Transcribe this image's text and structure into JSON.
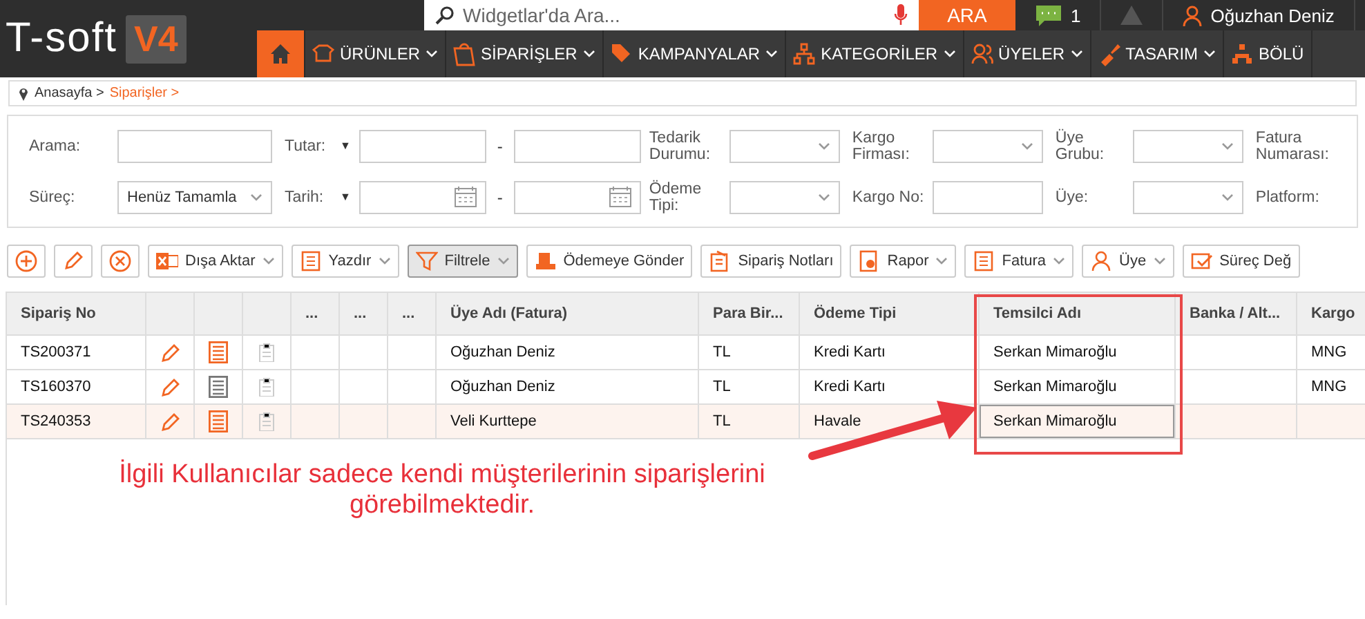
{
  "logo": {
    "text": "T-soft",
    "badge": "V4"
  },
  "search": {
    "placeholder": "Widgetlar'da Ara...",
    "button": "ARA"
  },
  "notifications": {
    "count": "1"
  },
  "user": {
    "name": "Oğuzhan Deniz"
  },
  "nav": [
    {
      "kind": "home",
      "selected": true
    },
    {
      "label": "ÜRÜNLER",
      "kind": "item",
      "selected": false
    },
    {
      "label": "SİPARİŞLER",
      "kind": "item",
      "selected": false
    },
    {
      "label": "KAMPANYALAR",
      "kind": "item",
      "selected": false
    },
    {
      "label": "KATEGORİLER",
      "kind": "item",
      "selected": false
    },
    {
      "label": "ÜYELER",
      "kind": "item",
      "selected": false
    },
    {
      "label": "TASARIM",
      "kind": "item",
      "selected": false
    },
    {
      "label": "BÖLÜ",
      "kind": "item",
      "selected": false
    }
  ],
  "breadcrumb": [
    {
      "label": "Anasayfa >",
      "current": false
    },
    {
      "label": "Siparişler >",
      "current": true
    }
  ],
  "filters": [
    [
      {
        "label": "Arama:",
        "kind": "input"
      },
      {
        "label": "Tutar:",
        "kind": "range",
        "operator": "▼",
        "separator": "-"
      },
      {
        "label": "Tedarik Durumu:",
        "kind": "select"
      },
      {
        "label": "Kargo Firması:",
        "kind": "select"
      },
      {
        "label": "Üye Grubu:",
        "kind": "select"
      },
      {
        "label": "Fatura Numarası:",
        "kind": "none"
      }
    ],
    [
      {
        "label": "Süreç:",
        "kind": "select",
        "value": "Henüz Tamamla"
      },
      {
        "label": "Tarih:",
        "kind": "daterange",
        "operator": "▼",
        "separator": "-"
      },
      {
        "label": "Ödeme Tipi:",
        "kind": "select"
      },
      {
        "label": "Kargo No:",
        "kind": "input"
      },
      {
        "label": "Üye:",
        "kind": "select"
      },
      {
        "label": "Platform:",
        "kind": "none"
      }
    ]
  ],
  "toolbar": [
    {
      "kind": "icon",
      "selected": false
    },
    {
      "kind": "icon",
      "selected": false
    },
    {
      "kind": "icon",
      "selected": false
    },
    {
      "kind": "button",
      "label": "Dışa Aktar",
      "dropdown": true,
      "selected": false
    },
    {
      "kind": "button",
      "label": "Yazdır",
      "dropdown": true,
      "selected": false
    },
    {
      "kind": "button",
      "label": "Filtrele",
      "dropdown": true,
      "selected": true
    },
    {
      "kind": "button",
      "label": "Ödemeye Gönder",
      "dropdown": false,
      "selected": false
    },
    {
      "kind": "button",
      "label": "Sipariş Notları",
      "dropdown": false,
      "selected": false
    },
    {
      "kind": "button",
      "label": "Rapor",
      "dropdown": true,
      "selected": false
    },
    {
      "kind": "button",
      "label": "Fatura",
      "dropdown": true,
      "selected": false
    },
    {
      "kind": "button",
      "label": "Üye",
      "dropdown": true,
      "selected": false
    },
    {
      "kind": "button",
      "label": "Süreç Değ",
      "dropdown": false,
      "selected": false
    }
  ],
  "table": {
    "columns": [
      {
        "kind": "text",
        "label": "Sipariş No"
      },
      {
        "kind": "icon"
      },
      {
        "kind": "icon"
      },
      {
        "kind": "icon"
      },
      {
        "kind": "text",
        "label": "..."
      },
      {
        "kind": "text",
        "label": "..."
      },
      {
        "kind": "text",
        "label": "..."
      },
      {
        "kind": "text",
        "label": "Üye Adı (Fatura)"
      },
      {
        "kind": "text",
        "label": "Para Bir..."
      },
      {
        "kind": "text",
        "label": "Ödeme Tipi"
      },
      {
        "kind": "text",
        "label": "Temsilci Adı"
      },
      {
        "kind": "text",
        "label": "Banka / Alt..."
      },
      {
        "kind": "text",
        "label": "Kargo"
      }
    ],
    "rows": [
      {
        "selected": false,
        "invoice_active": true,
        "order_no": "TS200371",
        "member": "Oğuzhan Deniz",
        "currency": "TL",
        "payment": "Kredi Kartı",
        "representative": "Serkan Mimaroğlu",
        "cargo": "MNG"
      },
      {
        "selected": false,
        "invoice_active": false,
        "order_no": "TS160370",
        "member": "Oğuzhan Deniz",
        "currency": "TL",
        "payment": "Kredi Kartı",
        "representative": "Serkan Mimaroğlu",
        "cargo": "MNG"
      },
      {
        "selected": true,
        "invoice_active": true,
        "order_no": "TS240353",
        "member": "Veli Kurttepe",
        "currency": "TL",
        "payment": "Havale",
        "representative": "Serkan Mimaroğlu"
      }
    ]
  },
  "annotation": {
    "text": "İlgili Kullanıcılar sadece kendi müşterilerinin siparişlerini görebilmektedir."
  }
}
